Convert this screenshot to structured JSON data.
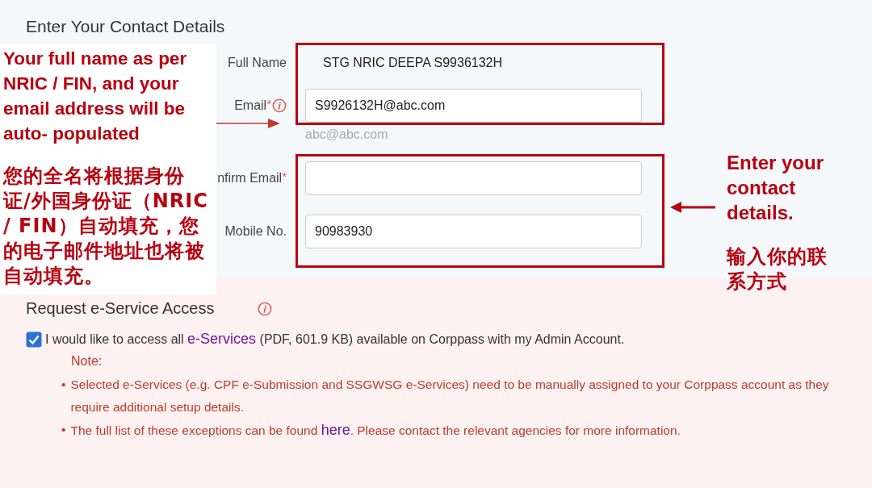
{
  "section_title": "Enter Your Contact Details",
  "fields": [
    {
      "kind": "static",
      "label": "Full Name",
      "value": "STG NRIC DEEPA S9936132H"
    },
    {
      "kind": "input",
      "label": "Email",
      "required_mark": "*",
      "info": true,
      "value": "S9926132H@abc.com",
      "hint": "abc@abc.com"
    },
    {
      "kind": "input",
      "label": "nfirm Email",
      "required_mark": "*"
    },
    {
      "kind": "input",
      "label": "Mobile No.",
      "value": "90983930"
    }
  ],
  "access": {
    "title": "Request e-Service Access",
    "info": true,
    "checked": true,
    "statement": {
      "before": "I would like to access all ",
      "link": "e-Services",
      "after": " (PDF, 601.9 KB) available on Corppass with my Admin Account."
    },
    "note_title": "Note:",
    "notes": [
      {
        "bullet": "•",
        "text": "Selected e-Services (e.g. CPF e-Submission and SSGWSG e-Services) need to be manually assigned to your Corppass account as they require additional setup details."
      },
      {
        "bullet": "•",
        "before": "The full list of these exceptions can be found ",
        "link": "here",
        "after": ". Please contact the relevant agencies for more information."
      }
    ]
  },
  "annotations": [
    {
      "kind": "left_callout",
      "english": "Your full name as per NRIC / FIN, and your email address will be auto- populated",
      "chinese": "您的全名将根据身份证/外国身份证（NRIC / FIN）自动填充，您的电子邮件地址也将被自动填充。"
    },
    {
      "kind": "right_callout",
      "english": "Enter your contact details.",
      "chinese": "输入你的联系方式"
    }
  ]
}
